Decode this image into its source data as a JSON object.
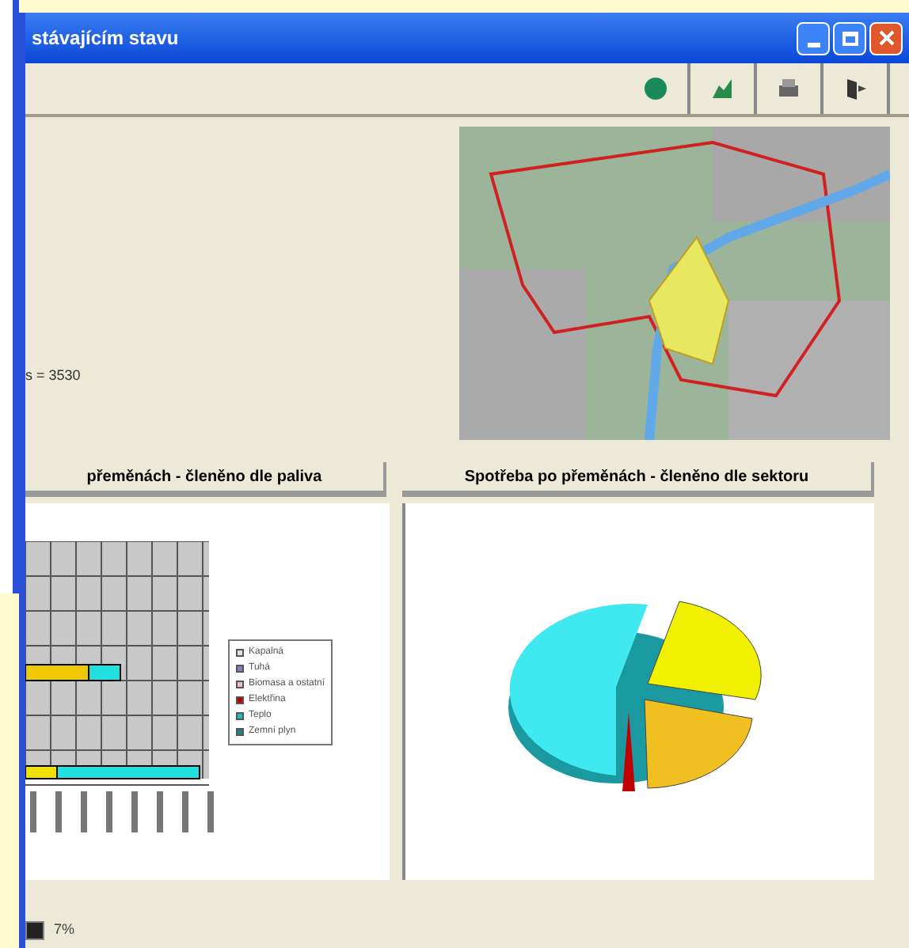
{
  "window": {
    "title": "stávajícím stavu"
  },
  "toolbar": {
    "buttons": [
      {
        "kind": "globe"
      },
      {
        "kind": "chart"
      },
      {
        "kind": "print"
      },
      {
        "kind": "exit"
      }
    ]
  },
  "info": {
    "text": "s = 3530"
  },
  "tabs": [
    {
      "label": "přeměnách - členěno dle paliva",
      "selected": false
    },
    {
      "label": "Spotřeba po přeměnách - členěno dle sektoru",
      "selected": false
    }
  ],
  "legend": [
    {
      "label": "Kapalná",
      "color": "#e0e0e0"
    },
    {
      "label": "Tuhá",
      "color": "#8080c0"
    },
    {
      "label": "Biomasa a ostatní",
      "color": "#f0c0c0"
    },
    {
      "label": "Elektřina",
      "color": "#c00000"
    },
    {
      "label": "Teplo",
      "color": "#20c0c0"
    },
    {
      "label": "Zemní plyn",
      "color": "#208080"
    }
  ],
  "status_bar": {
    "text": "7%"
  }
}
